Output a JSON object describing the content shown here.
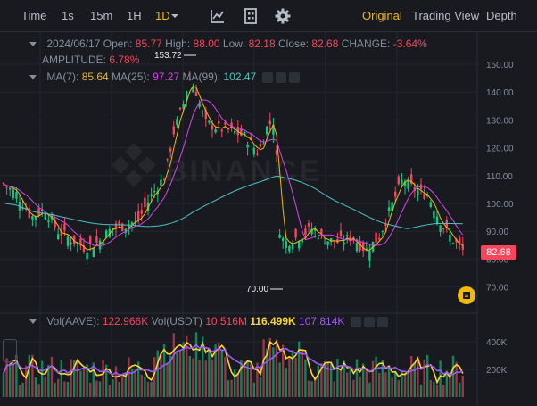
{
  "toolbar": {
    "time": "Time",
    "intervals": [
      "1s",
      "15m",
      "1H",
      "1D"
    ],
    "active_interval": "1D",
    "view_modes": [
      "Original",
      "Trading View",
      "Depth"
    ],
    "active_view": "Original",
    "icons": [
      "indicators-icon",
      "layout-icon",
      "settings-icon"
    ]
  },
  "ohlc": {
    "date": "2024/06/17",
    "open_label": "Open:",
    "open": "85.77",
    "high_label": "High:",
    "high": "88.00",
    "low_label": "Low:",
    "low": "82.18",
    "close_label": "Close:",
    "close": "82.68",
    "change_label": "CHANGE:",
    "change": "-3.64%",
    "amplitude_label": "AMPLITUDE:",
    "amplitude": "6.78%"
  },
  "ma": {
    "ma7_label": "MA(7):",
    "ma7": "85.64",
    "ma25_label": "MA(25):",
    "ma25": "97.27",
    "ma99_label": "MA(99):",
    "ma99": "102.47"
  },
  "vol": {
    "aave_label": "Vol(AAVE):",
    "aave": "122.966K",
    "usdt_label": "Vol(USDT)",
    "usdt": "10.516M",
    "v1": "116.499K",
    "v2": "107.814K"
  },
  "price_axis": [
    "150.00",
    "140.00",
    "130.00",
    "120.00",
    "110.00",
    "100.00",
    "90.00",
    "80.00",
    "70.00"
  ],
  "vol_axis": [
    "400K",
    "200K"
  ],
  "annotations": {
    "high_marker": "153.72",
    "low_marker": "70.00",
    "last_price": "82.68"
  },
  "colors": {
    "up": "#0ecb81",
    "down": "#f6465d",
    "accent": "#f0b90b",
    "ma7": "#f0b90b",
    "ma25": "#d346e6",
    "ma99": "#4dc2c0"
  }
}
